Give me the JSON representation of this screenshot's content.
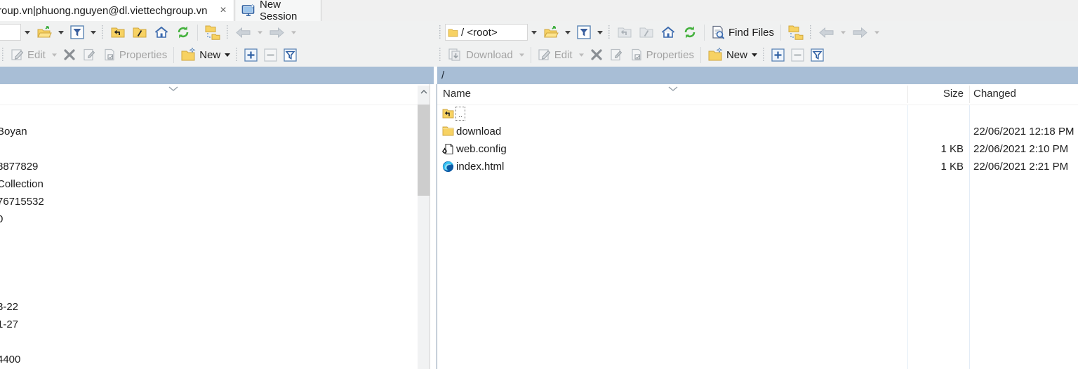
{
  "window": {
    "tab_title": "roup.vn|phuong.nguyen@dl.viettechgroup.vn",
    "tab_close": "×",
    "new_session_label": "New Session"
  },
  "left_pane": {
    "toolbar": {
      "edit": "Edit",
      "properties": "Properties",
      "new": "New"
    },
    "path": "",
    "fragments": [
      {
        "row": 1,
        "text": "Boyan"
      },
      {
        "row": 3,
        "text": "8877829"
      },
      {
        "row": 4,
        "text": "Collection"
      },
      {
        "row": 5,
        "text": "76715532"
      },
      {
        "row": 6,
        "text": "0"
      },
      {
        "row": 11,
        "text": "3-22"
      },
      {
        "row": 12,
        "text": "1-27"
      },
      {
        "row": 14,
        "text": "4400"
      }
    ]
  },
  "right_pane": {
    "address": "/ <root>",
    "toolbar": {
      "download": "Download",
      "edit": "Edit",
      "properties": "Properties",
      "new": "New",
      "find_files": "Find Files"
    },
    "path": "/",
    "columns": {
      "name": "Name",
      "size": "Size",
      "changed": "Changed"
    },
    "files": [
      {
        "icon": "parent-folder-icon",
        "name": "..",
        "size": "",
        "changed": "",
        "focused": true
      },
      {
        "icon": "folder-icon",
        "name": "download",
        "size": "",
        "changed": "22/06/2021 12:18 PM",
        "focused": false
      },
      {
        "icon": "config-file-icon",
        "name": "web.config",
        "size": "1 KB",
        "changed": "22/06/2021 2:10 PM",
        "focused": false
      },
      {
        "icon": "edge-html-icon",
        "name": "index.html",
        "size": "1 KB",
        "changed": "22/06/2021 2:21 PM",
        "focused": false
      }
    ]
  },
  "colors": {
    "path_bar": "#a8bed6",
    "toolbar_bg": "#f0f1f1",
    "accent_blue": "#2e5fa3",
    "folder_yellow": "#fbd56a",
    "refresh_green": "#44b13d",
    "disabled_text": "#a3a3a3"
  }
}
